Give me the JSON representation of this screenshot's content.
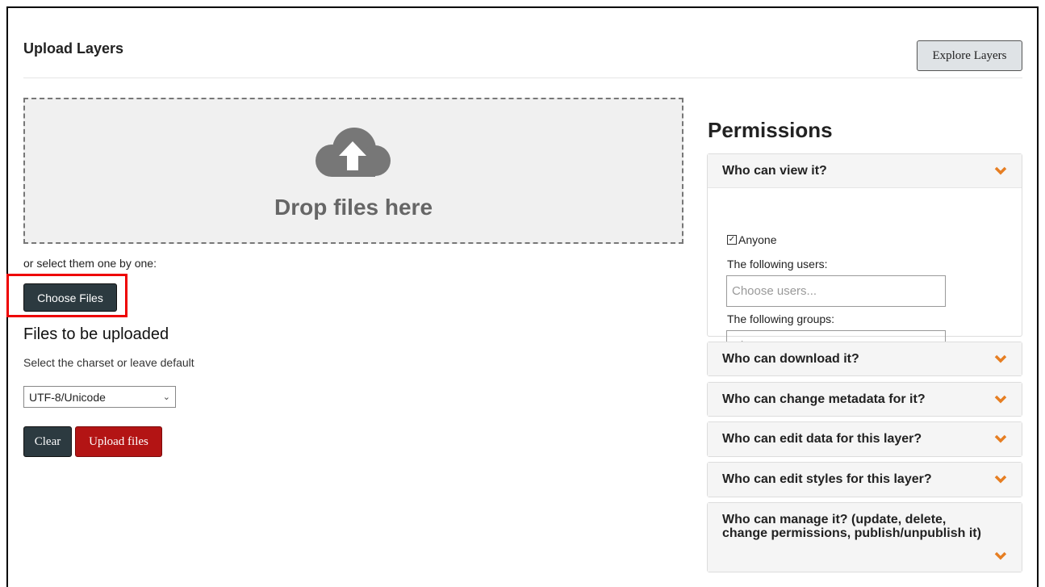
{
  "header": {
    "title": "Upload Layers",
    "explore_label": "Explore Layers"
  },
  "dropzone": {
    "text": "Drop files here"
  },
  "upload": {
    "or_select": "or select them one by one:",
    "choose_label": "Choose Files",
    "files_heading": "Files to be uploaded",
    "charset_label": "Select the charset or leave default",
    "charset_value": "UTF-8/Unicode",
    "clear_label": "Clear",
    "upload_label": "Upload files"
  },
  "permissions": {
    "heading": "Permissions",
    "view": {
      "title": "Who can view it?",
      "anyone_label": "Anyone",
      "anyone_checked": true,
      "users_label": "The following users:",
      "users_placeholder": "Choose users...",
      "groups_label": "The following groups:",
      "groups_placeholder": "Choose groups..."
    },
    "download_title": "Who can download it?",
    "metadata_title": "Who can change metadata for it?",
    "edit_data_title": "Who can edit data for this layer?",
    "edit_styles_title": "Who can edit styles for this layer?",
    "manage_title": "Who can manage it? (update, delete, change permissions, publish/unpublish it)"
  },
  "colors": {
    "accent_orange": "#e67e22",
    "upload_red": "#b31414",
    "dark_button": "#2c3a40",
    "highlight": "#ee0000"
  }
}
